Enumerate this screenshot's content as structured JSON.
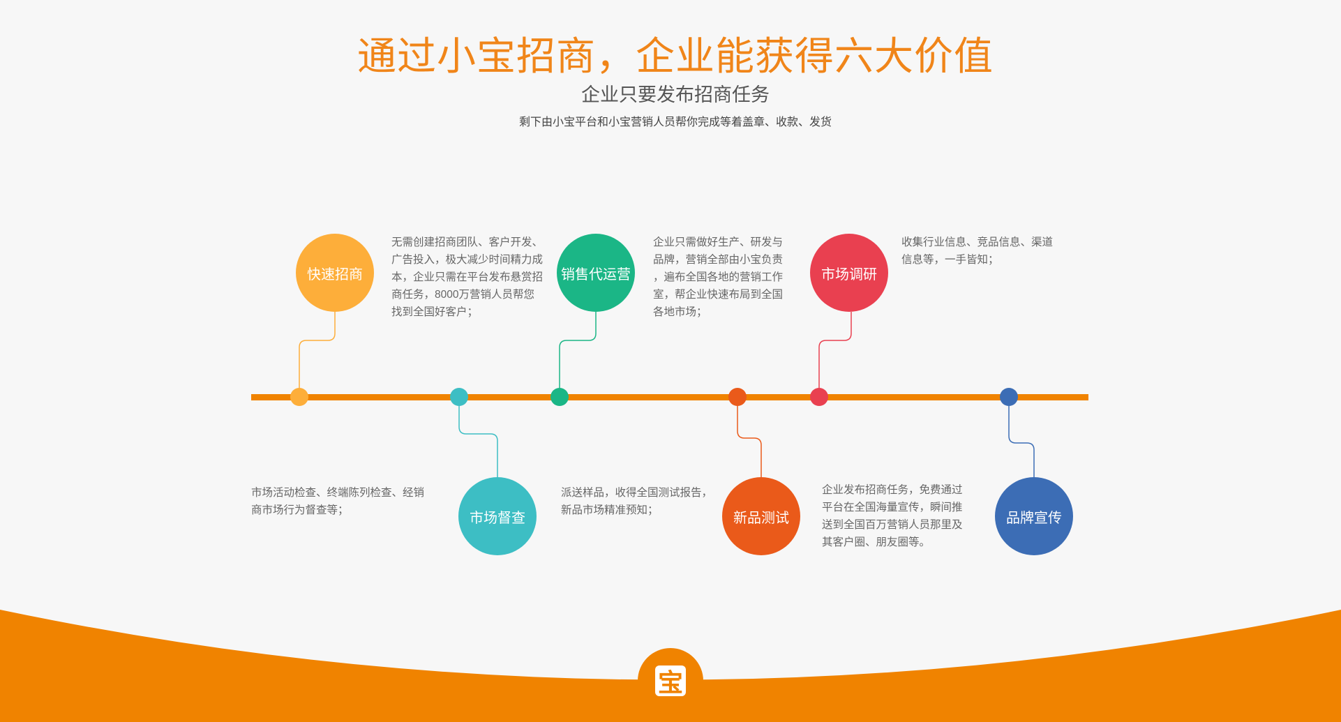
{
  "header": {
    "title": "通过小宝招商，企业能获得六大价值",
    "subtitle": "企业只要发布招商任务",
    "tagline": "剩下由小宝平台和小宝营销人员帮你完成等着盖章、收款、发货"
  },
  "colors": {
    "accent": "#f08300",
    "fast": "#fdae3a",
    "sales": "#1bb686",
    "research": "#e94050",
    "supervise": "#3dbec4",
    "newproduct": "#ea5a1a",
    "brand": "#3c6db5"
  },
  "values": [
    {
      "label": "快速招商",
      "desc": [
        "无需创建招商团队、客户开发、",
        "广告投入，极大减少时间精力成",
        "本，企业只需在平台发布悬赏招",
        "商任务，8000万营销人员帮您",
        "找到全国好客户；"
      ]
    },
    {
      "label": "市场督查",
      "desc": [
        "市场活动检查、终端陈列检查、经销",
        "商市场行为督查等；"
      ]
    },
    {
      "label": "销售代运营",
      "desc": [
        "企业只需做好生产、研发与",
        "品牌，营销全部由小宝负责",
        "，遍布全国各地的营销工作",
        "室，帮企业快速布局到全国",
        "各地市场；"
      ]
    },
    {
      "label": "新品测试",
      "desc": [
        "派送样品，收得全国测试报告，",
        "新品市场精准预知；"
      ]
    },
    {
      "label": "市场调研",
      "desc": [
        "收集行业信息、竞品信息、渠道",
        "信息等，一手皆知；"
      ]
    },
    {
      "label": "品牌宣传",
      "desc": [
        "企业发布招商任务，免费通过",
        "平台在全国海量宣传，瞬间推",
        "送到全国百万营销人员那里及",
        "其客户圈、朋友圈等。"
      ]
    }
  ],
  "logo": {
    "char": "宝"
  }
}
